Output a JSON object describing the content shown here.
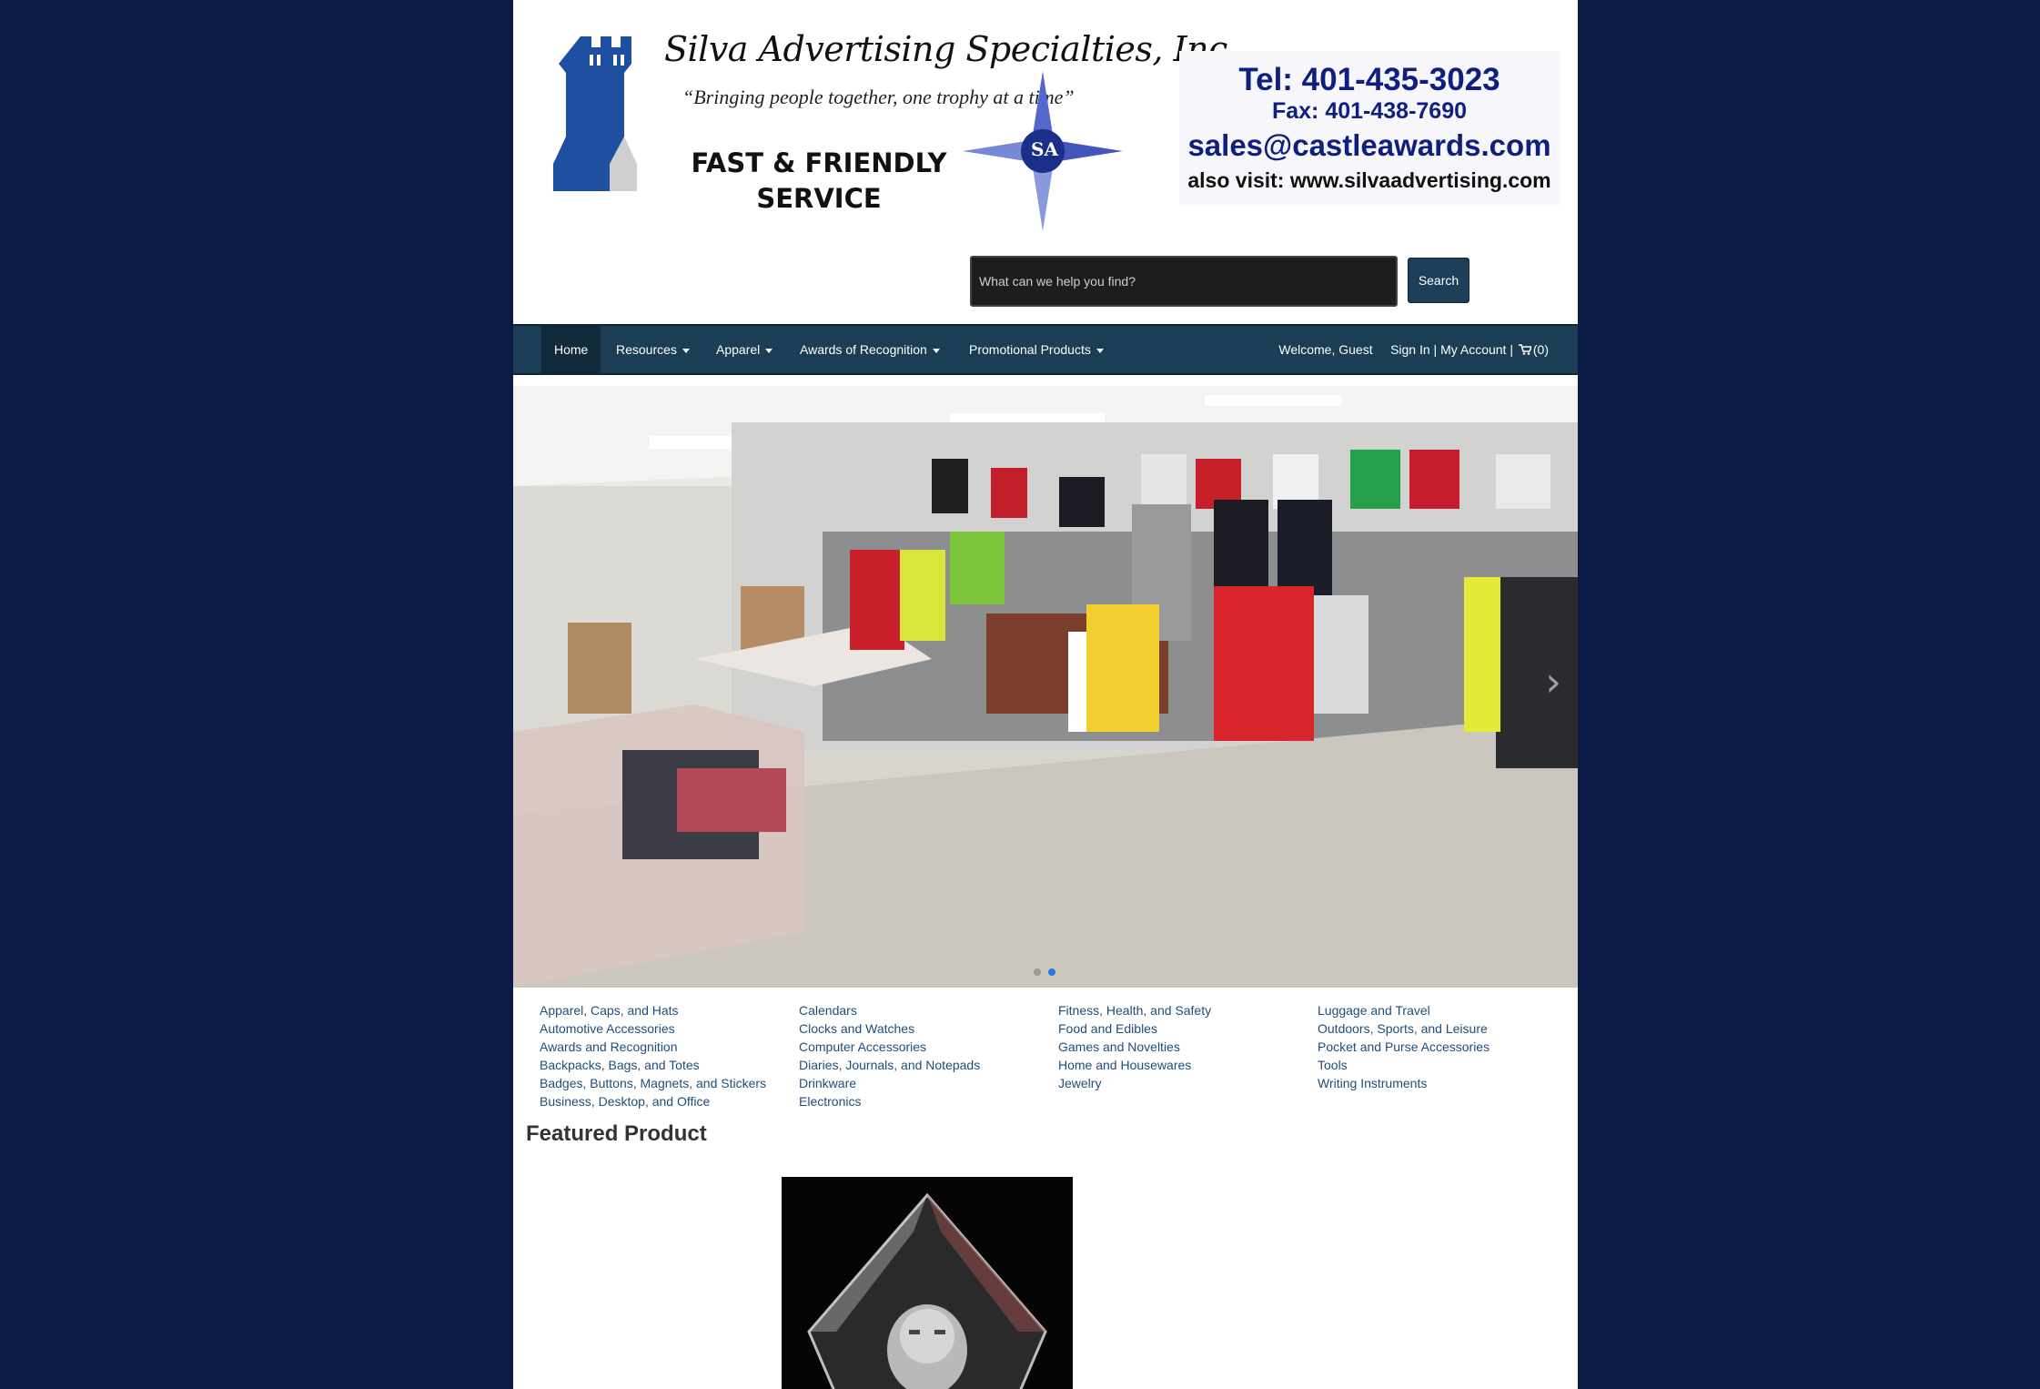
{
  "header": {
    "company_name": "Silva Advertising Specialties, Inc.",
    "tagline": "“Bringing people together, one trophy at a time”",
    "slogan_line1": "FAST & FRIENDLY",
    "slogan_line2": "SERVICE",
    "logo_initials": "SA",
    "tel": "Tel: 401-435-3023",
    "fax": "Fax:  401-438-7690",
    "email": "sales@castleawards.com",
    "also_visit": "also visit: www.silvaadvertising.com"
  },
  "search": {
    "placeholder": "What can we help you find?",
    "button_label": "Search"
  },
  "nav": {
    "home": "Home",
    "resources": "Resources",
    "apparel": "Apparel",
    "awards": "Awards of Recognition",
    "promotional": "Promotional Products",
    "welcome": "Welcome, Guest",
    "sign_in": "Sign In",
    "separator": "|",
    "my_account": "My Account",
    "cart_count": "(0)"
  },
  "carousel": {
    "slide_count": 2,
    "active_slide": 2
  },
  "categories": {
    "col1": [
      "Apparel, Caps, and Hats",
      "Automotive Accessories",
      "Awards and Recognition",
      "Backpacks, Bags, and Totes",
      "Badges, Buttons, Magnets, and Stickers",
      "Business, Desktop, and Office"
    ],
    "col2": [
      "Calendars",
      "Clocks and Watches",
      "Computer Accessories",
      "Diaries, Journals, and Notepads",
      "Drinkware",
      "Electronics"
    ],
    "col3": [
      "Fitness, Health, and Safety",
      "Food and Edibles",
      "Games and Novelties",
      "Home and Housewares",
      "Jewelry"
    ],
    "col4": [
      "Luggage and Travel",
      "Outdoors, Sports, and Leisure",
      "Pocket and Purse Accessories",
      "Tools",
      "Writing Instruments"
    ]
  },
  "featured": {
    "title": "Featured Product"
  },
  "colors": {
    "background": "#0b1b45",
    "navbar": "#1b3d55",
    "link": "#1f4e7a",
    "contact_blue": "#0f1f80",
    "castle_blue": "#1f4fa0"
  }
}
